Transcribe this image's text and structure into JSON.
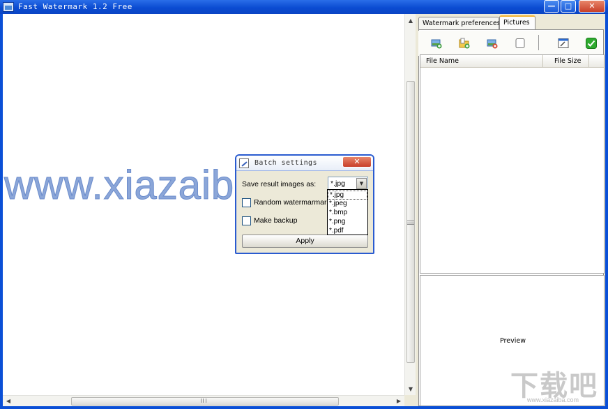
{
  "window": {
    "title": "Fast Watermark 1.2 Free",
    "minimize": "—",
    "maximize": "□",
    "close": "✕"
  },
  "canvas": {
    "watermark_text": "www.xiazaiba.com"
  },
  "scrollbars": {
    "up": "▲",
    "down": "▼",
    "left": "◀",
    "right": "▶"
  },
  "right_panel": {
    "tabs": [
      {
        "label": "Watermark preferences",
        "active": false
      },
      {
        "label": "Pictures",
        "active": true
      }
    ],
    "toolbar": [
      {
        "icon": "add-image-icon",
        "color": "#3a9a3a"
      },
      {
        "icon": "add-folder-icon",
        "color": "#d9a520"
      },
      {
        "icon": "remove-image-icon",
        "color": "#d0402a"
      },
      {
        "icon": "clear-list-icon",
        "color": "#ffffff"
      },
      {
        "icon": "batch-settings-icon",
        "color": "#2a6ad0"
      },
      {
        "icon": "apply-check-icon",
        "color": "#2faa2f"
      }
    ],
    "list_columns": [
      "File Name",
      "File Size"
    ],
    "preview_label": "Preview"
  },
  "dialog": {
    "title": "Batch settings",
    "close": "✕",
    "save_label": "Save result images as:",
    "format_value": "*.jpg",
    "format_options": [
      "*.jpg",
      "*.jpeg",
      "*.bmp",
      "*.png",
      "*.pdf"
    ],
    "random_label": "Random watermarmark",
    "backup_label": "Make backup",
    "apply_label": "Apply"
  },
  "site_watermark": {
    "logo_text": "下载吧",
    "url": "www.xiazaiba.com"
  }
}
